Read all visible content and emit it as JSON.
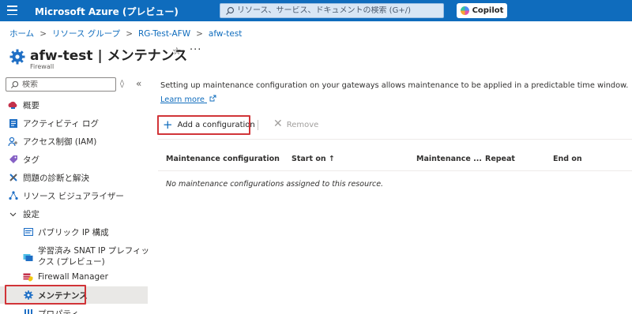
{
  "topbar": {
    "brand": "Microsoft Azure (プレビュー)",
    "search_placeholder": "リソース、サービス、ドキュメントの検索 (G+/)",
    "copilot_label": "Copilot"
  },
  "breadcrumb": [
    "ホーム",
    "リソース グループ",
    "RG-Test-AFW",
    "afw-test"
  ],
  "page": {
    "title": "afw-test | メンテナンス",
    "subtitle": "Firewall",
    "more_label": "···"
  },
  "sidebar": {
    "search_placeholder": "検索",
    "items": [
      {
        "label": "概要",
        "icon": "overview-icon"
      },
      {
        "label": "アクティビティ ログ",
        "icon": "activity-log-icon"
      },
      {
        "label": "アクセス制御 (IAM)",
        "icon": "iam-icon"
      },
      {
        "label": "タグ",
        "icon": "tag-icon"
      },
      {
        "label": "問題の診断と解決",
        "icon": "diagnose-icon"
      },
      {
        "label": "リソース ビジュアライザー",
        "icon": "visualizer-icon"
      },
      {
        "label": "設定",
        "icon": "chevron-down-icon"
      },
      {
        "label": "パブリック IP 構成",
        "icon": "public-ip-icon"
      },
      {
        "label": "学習済み SNAT IP プレフィッ",
        "label2": "クス (プレビュー)",
        "icon": "snat-icon"
      },
      {
        "label": "Firewall Manager",
        "icon": "firewall-manager-icon"
      },
      {
        "label": "メンテナンス",
        "icon": "maintenance-icon"
      },
      {
        "label": "プロパティ",
        "icon": "properties-icon"
      }
    ]
  },
  "main": {
    "description": "Setting up maintenance configuration on your gateways allows maintenance to be applied in a predictable time window.",
    "learn_more": "Learn more",
    "add_label": "Add a configuration",
    "remove_label": "Remove",
    "columns": [
      "Maintenance configuration",
      "Start on ↑",
      "Maintenance ...",
      "Repeat",
      "End on"
    ],
    "empty_message": "No maintenance configurations assigned to this resource."
  },
  "colors": {
    "accent": "#0f6cbd",
    "highlight_box": "#d13438"
  }
}
